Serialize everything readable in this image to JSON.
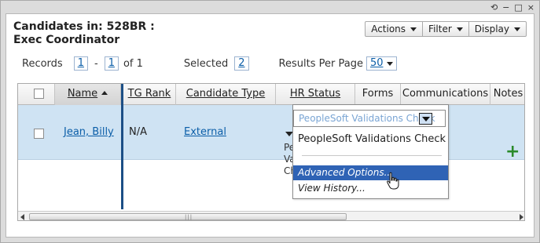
{
  "window": {
    "controls": [
      "⟲",
      "−",
      "□",
      "×"
    ]
  },
  "title": "Candidates in: 528BR : Exec Coordinator",
  "toolbar": {
    "actions": "Actions",
    "filter": "Filter",
    "display": "Display"
  },
  "pager": {
    "records_label": "Records",
    "from": "1",
    "dash": "-",
    "to": "1",
    "of": "of 1",
    "selected_label": "Selected",
    "selected_count": "2",
    "per_page_label": "Results Per Page",
    "per_page_value": "50"
  },
  "table": {
    "columns": [
      "Name",
      "TG Rank",
      "Candidate Type",
      "HR Status",
      "Forms",
      "Communications",
      "Notes"
    ],
    "rows": [
      {
        "name": "Jean, Billy",
        "tg_rank": "N/A",
        "candidate_type": "External",
        "hr_status_fragment": "Peo Va Ch"
      }
    ]
  },
  "popup": {
    "select_value": "PeopleSoft Validations Check",
    "option_label": "PeopleSoft Validations Check",
    "menu": [
      "Advanced Options...",
      "View History..."
    ]
  },
  "colors": {
    "accent": "#2f63b5",
    "link": "#0b5ea8",
    "row_bg": "#cfe3f3",
    "add_icon": "#2a8a2a"
  }
}
